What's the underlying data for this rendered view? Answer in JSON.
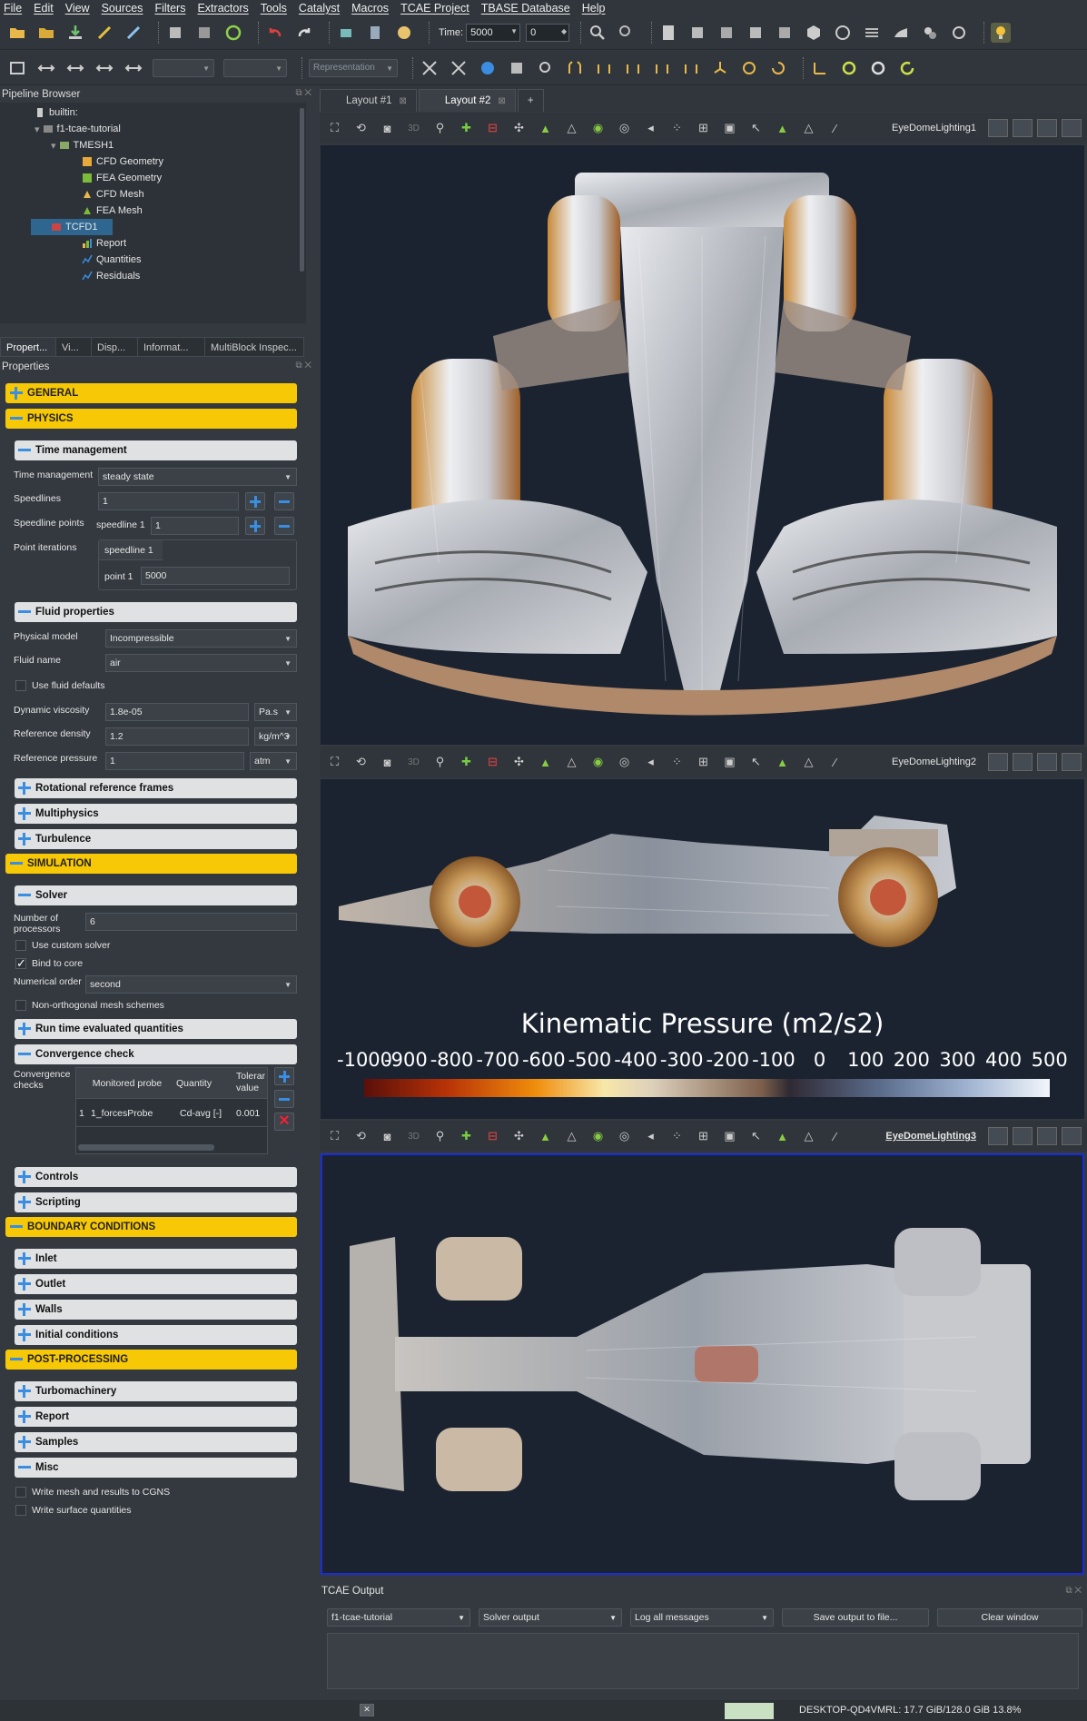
{
  "menu": [
    "File",
    "Edit",
    "View",
    "Sources",
    "Filters",
    "Extractors",
    "Tools",
    "Catalyst",
    "Macros",
    "TCAE Project",
    "TBASE Database",
    "Help"
  ],
  "toolbar": {
    "time_label": "Time:",
    "time_value": "5000",
    "time_index": "0",
    "representation": "Representation"
  },
  "pipeline": {
    "title": "Pipeline Browser",
    "items": [
      "builtin:",
      "f1-tcae-tutorial",
      "TMESH1",
      "CFD Geometry",
      "FEA Geometry",
      "CFD Mesh",
      "FEA Mesh",
      "TCFD1",
      "Report",
      "Quantities",
      "Residuals"
    ]
  },
  "panel_tabs": [
    "Propert...",
    "Vi...",
    "Disp...",
    "Informat...",
    "MultiBlock Inspec..."
  ],
  "properties": {
    "title": "Properties",
    "general": "GENERAL",
    "physics": "PHYSICS",
    "time_mgmt_head": "Time management",
    "time_mgmt_label": "Time management",
    "time_mgmt_value": "steady state",
    "speedlines_label": "Speedlines",
    "speedlines_value": "1",
    "speedline_points_label": "Speedline points",
    "speedline1_label": "speedline 1",
    "speedline1_value": "1",
    "point_iter_label": "Point iterations",
    "point_iter_group": "speedline 1",
    "point1_label": "point 1",
    "point1_value": "5000",
    "fluid_head": "Fluid properties",
    "phys_model_label": "Physical model",
    "phys_model_value": "Incompressible",
    "fluid_name_label": "Fluid name",
    "fluid_name_value": "air",
    "use_defaults": "Use fluid defaults",
    "dyn_visc_label": "Dynamic viscosity",
    "dyn_visc_value": "1.8e-05",
    "dyn_visc_unit": "Pa.s",
    "ref_dens_label": "Reference density",
    "ref_dens_value": "1.2",
    "ref_dens_unit": "kg/m^3",
    "ref_press_label": "Reference pressure",
    "ref_press_value": "1",
    "ref_press_unit": "atm",
    "rot_frames": "Rotational reference frames",
    "multiphysics": "Multiphysics",
    "turbulence": "Turbulence",
    "simulation": "SIMULATION",
    "solver": "Solver",
    "nproc_label": "Number of processors",
    "nproc_value": "6",
    "custom_solver": "Use custom solver",
    "bind_core": "Bind to core",
    "num_order_label": "Numerical order",
    "num_order_value": "second",
    "non_ortho": "Non-orthogonal mesh schemes",
    "runtime_q": "Run time evaluated quantities",
    "conv_check": "Convergence check",
    "conv_checks_label": "Convergence checks",
    "conv_cols": [
      "Monitored probe",
      "Quantity",
      "Tolerance value"
    ],
    "conv_row": {
      "idx": "1",
      "probe": "1_forcesProbe",
      "qty": "Cd-avg [-]",
      "tol": "0.001"
    },
    "controls": "Controls",
    "scripting": "Scripting",
    "boundary": "BOUNDARY CONDITIONS",
    "inlet": "Inlet",
    "outlet": "Outlet",
    "walls": "Walls",
    "initial": "Initial conditions",
    "post": "POST-PROCESSING",
    "turbo": "Turbomachinery",
    "report": "Report",
    "samples": "Samples",
    "misc": "Misc",
    "write_cgns": "Write mesh and results to CGNS",
    "write_surf": "Write surface quantities"
  },
  "layout_tabs": [
    "Layout #1",
    "Layout #2",
    "+"
  ],
  "views": [
    {
      "name": "EyeDomeLighting1"
    },
    {
      "name": "EyeDomeLighting2"
    },
    {
      "name": "EyeDomeLighting3"
    }
  ],
  "colorbar": {
    "title": "Kinematic Pressure (m2/s2)",
    "ticks": [
      "-1000",
      "-900",
      "-800",
      "-700",
      "-600",
      "-500",
      "-400",
      "-300",
      "-200",
      "-100",
      "0",
      "100",
      "200",
      "300",
      "400",
      "500"
    ]
  },
  "output": {
    "title": "TCAE Output",
    "project": "f1-tcae-tutorial",
    "source": "Solver output",
    "level": "Log all messages",
    "save": "Save output to file...",
    "clear": "Clear window"
  },
  "status": {
    "memory": "DESKTOP-QD4VMRL: 17.7 GiB/128.0 GiB 13.8%"
  },
  "colors": {
    "accent": "#f7c805",
    "blue": "#3a8de0",
    "view_bg": "#1b2330"
  }
}
